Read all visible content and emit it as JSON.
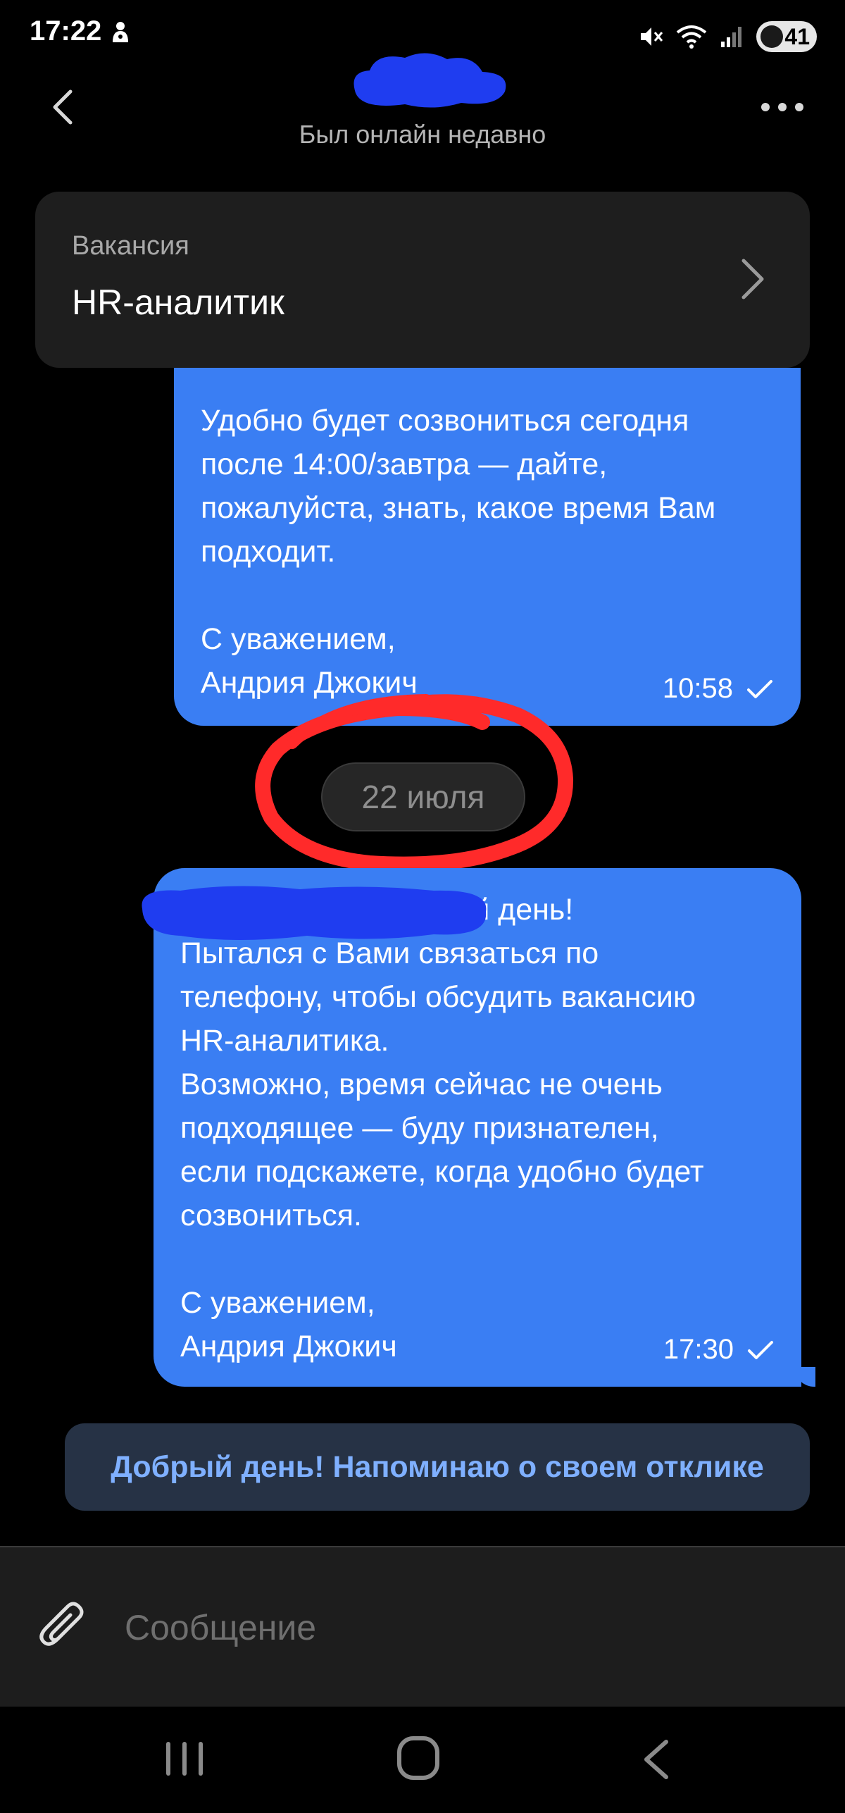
{
  "status_bar": {
    "time": "17:22",
    "battery": "41"
  },
  "header": {
    "presence": "Был онлайн недавно"
  },
  "vacancy": {
    "label": "Вакансия",
    "title": "HR-аналитик"
  },
  "messages": [
    {
      "text": "Удобно будет созвониться сегодня\nпосле 14:00/завтра — дайте,\nпожалуйста, знать, какое время Вам\nподходит.\n\nС уважением,\nАндрия Джокич",
      "time": "10:58"
    },
    {
      "text": "                        добрый день!\nПытался с Вами связаться по\nтелефону, чтобы обсудить вакансию\nHR-аналитика.\nВозможно, время сейчас не очень\nподходящее — буду признателен,\nесли подскажете, когда удобно будет\nсозвониться.\n\nС уважением,\nАндрия Джокич",
      "time": "17:30"
    }
  ],
  "date_separator": "22 июля",
  "suggestion": "Добрый день! Напоминаю о своем отклике",
  "composer": {
    "placeholder": "Сообщение"
  },
  "colors": {
    "bubble": "#3a7ef3",
    "suggestion_text": "#7fb0ff",
    "annotation": "#ff2a2a",
    "redaction": "#1f3df0"
  }
}
